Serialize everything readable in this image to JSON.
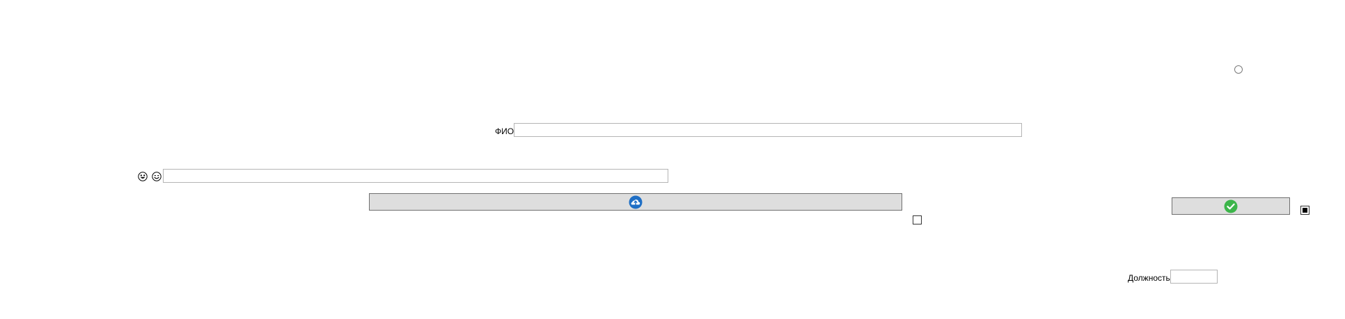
{
  "form": {
    "fio_label": "ФИО",
    "fio_value": "",
    "position_label": "Должность",
    "position_value": "",
    "search_value": ""
  },
  "icons": {
    "grinning_face": "grinning-face-icon",
    "smiling_face": "smiling-face-icon",
    "upload_button_icon": "cloud-upload-icon",
    "confirm_button_icon": "check-circle-icon"
  },
  "states": {
    "checkbox_right": "indeterminate",
    "checkbox_middle": "unchecked",
    "radio": "unselected"
  },
  "colors": {
    "button_bg": "#dedede",
    "upload_icon": "#1f6fc5",
    "confirm_icon": "#3cb54a"
  }
}
